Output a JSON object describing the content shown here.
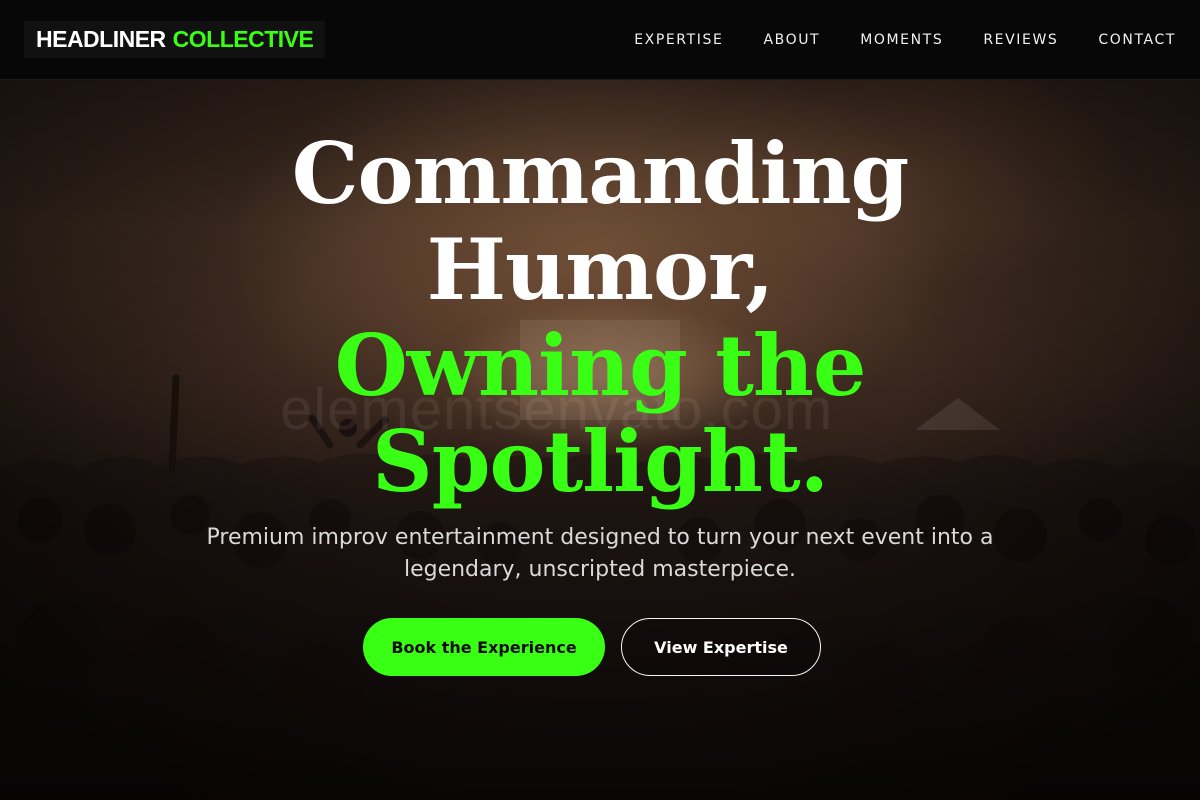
{
  "brand": {
    "name_part1": "HEADLINER",
    "name_part2": "COLLECTIVE",
    "accent_color": "#39ff14"
  },
  "nav": {
    "items": [
      {
        "label": "EXPERTISE"
      },
      {
        "label": "ABOUT"
      },
      {
        "label": "MOMENTS"
      },
      {
        "label": "REVIEWS"
      },
      {
        "label": "CONTACT"
      }
    ]
  },
  "hero": {
    "headline_line1": "Commanding",
    "headline_line2": "Humor,",
    "headline_line3": "Owning the",
    "headline_line4": "Spotlight.",
    "subtitle": "Premium improv entertainment designed to turn your next event into a legendary, unscripted masterpiece.",
    "primary_cta": "Book the Experience",
    "secondary_cta": "View Expertise",
    "watermark": "elementsenvato.com",
    "background_image": "concert-crowd-photo"
  }
}
